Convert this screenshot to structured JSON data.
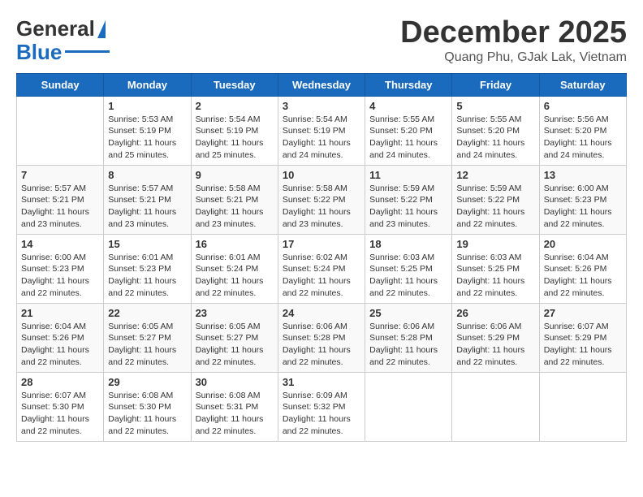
{
  "logo": {
    "line1": "General",
    "line2": "Blue"
  },
  "title": "December 2025",
  "subtitle": "Quang Phu, GJak Lak, Vietnam",
  "days_header": [
    "Sunday",
    "Monday",
    "Tuesday",
    "Wednesday",
    "Thursday",
    "Friday",
    "Saturday"
  ],
  "weeks": [
    [
      {
        "num": "",
        "info": ""
      },
      {
        "num": "1",
        "info": "Sunrise: 5:53 AM\nSunset: 5:19 PM\nDaylight: 11 hours\nand 25 minutes."
      },
      {
        "num": "2",
        "info": "Sunrise: 5:54 AM\nSunset: 5:19 PM\nDaylight: 11 hours\nand 25 minutes."
      },
      {
        "num": "3",
        "info": "Sunrise: 5:54 AM\nSunset: 5:19 PM\nDaylight: 11 hours\nand 24 minutes."
      },
      {
        "num": "4",
        "info": "Sunrise: 5:55 AM\nSunset: 5:20 PM\nDaylight: 11 hours\nand 24 minutes."
      },
      {
        "num": "5",
        "info": "Sunrise: 5:55 AM\nSunset: 5:20 PM\nDaylight: 11 hours\nand 24 minutes."
      },
      {
        "num": "6",
        "info": "Sunrise: 5:56 AM\nSunset: 5:20 PM\nDaylight: 11 hours\nand 24 minutes."
      }
    ],
    [
      {
        "num": "7",
        "info": "Sunrise: 5:57 AM\nSunset: 5:21 PM\nDaylight: 11 hours\nand 23 minutes."
      },
      {
        "num": "8",
        "info": "Sunrise: 5:57 AM\nSunset: 5:21 PM\nDaylight: 11 hours\nand 23 minutes."
      },
      {
        "num": "9",
        "info": "Sunrise: 5:58 AM\nSunset: 5:21 PM\nDaylight: 11 hours\nand 23 minutes."
      },
      {
        "num": "10",
        "info": "Sunrise: 5:58 AM\nSunset: 5:22 PM\nDaylight: 11 hours\nand 23 minutes."
      },
      {
        "num": "11",
        "info": "Sunrise: 5:59 AM\nSunset: 5:22 PM\nDaylight: 11 hours\nand 23 minutes."
      },
      {
        "num": "12",
        "info": "Sunrise: 5:59 AM\nSunset: 5:22 PM\nDaylight: 11 hours\nand 22 minutes."
      },
      {
        "num": "13",
        "info": "Sunrise: 6:00 AM\nSunset: 5:23 PM\nDaylight: 11 hours\nand 22 minutes."
      }
    ],
    [
      {
        "num": "14",
        "info": "Sunrise: 6:00 AM\nSunset: 5:23 PM\nDaylight: 11 hours\nand 22 minutes."
      },
      {
        "num": "15",
        "info": "Sunrise: 6:01 AM\nSunset: 5:23 PM\nDaylight: 11 hours\nand 22 minutes."
      },
      {
        "num": "16",
        "info": "Sunrise: 6:01 AM\nSunset: 5:24 PM\nDaylight: 11 hours\nand 22 minutes."
      },
      {
        "num": "17",
        "info": "Sunrise: 6:02 AM\nSunset: 5:24 PM\nDaylight: 11 hours\nand 22 minutes."
      },
      {
        "num": "18",
        "info": "Sunrise: 6:03 AM\nSunset: 5:25 PM\nDaylight: 11 hours\nand 22 minutes."
      },
      {
        "num": "19",
        "info": "Sunrise: 6:03 AM\nSunset: 5:25 PM\nDaylight: 11 hours\nand 22 minutes."
      },
      {
        "num": "20",
        "info": "Sunrise: 6:04 AM\nSunset: 5:26 PM\nDaylight: 11 hours\nand 22 minutes."
      }
    ],
    [
      {
        "num": "21",
        "info": "Sunrise: 6:04 AM\nSunset: 5:26 PM\nDaylight: 11 hours\nand 22 minutes."
      },
      {
        "num": "22",
        "info": "Sunrise: 6:05 AM\nSunset: 5:27 PM\nDaylight: 11 hours\nand 22 minutes."
      },
      {
        "num": "23",
        "info": "Sunrise: 6:05 AM\nSunset: 5:27 PM\nDaylight: 11 hours\nand 22 minutes."
      },
      {
        "num": "24",
        "info": "Sunrise: 6:06 AM\nSunset: 5:28 PM\nDaylight: 11 hours\nand 22 minutes."
      },
      {
        "num": "25",
        "info": "Sunrise: 6:06 AM\nSunset: 5:28 PM\nDaylight: 11 hours\nand 22 minutes."
      },
      {
        "num": "26",
        "info": "Sunrise: 6:06 AM\nSunset: 5:29 PM\nDaylight: 11 hours\nand 22 minutes."
      },
      {
        "num": "27",
        "info": "Sunrise: 6:07 AM\nSunset: 5:29 PM\nDaylight: 11 hours\nand 22 minutes."
      }
    ],
    [
      {
        "num": "28",
        "info": "Sunrise: 6:07 AM\nSunset: 5:30 PM\nDaylight: 11 hours\nand 22 minutes."
      },
      {
        "num": "29",
        "info": "Sunrise: 6:08 AM\nSunset: 5:30 PM\nDaylight: 11 hours\nand 22 minutes."
      },
      {
        "num": "30",
        "info": "Sunrise: 6:08 AM\nSunset: 5:31 PM\nDaylight: 11 hours\nand 22 minutes."
      },
      {
        "num": "31",
        "info": "Sunrise: 6:09 AM\nSunset: 5:32 PM\nDaylight: 11 hours\nand 22 minutes."
      },
      {
        "num": "",
        "info": ""
      },
      {
        "num": "",
        "info": ""
      },
      {
        "num": "",
        "info": ""
      }
    ]
  ]
}
